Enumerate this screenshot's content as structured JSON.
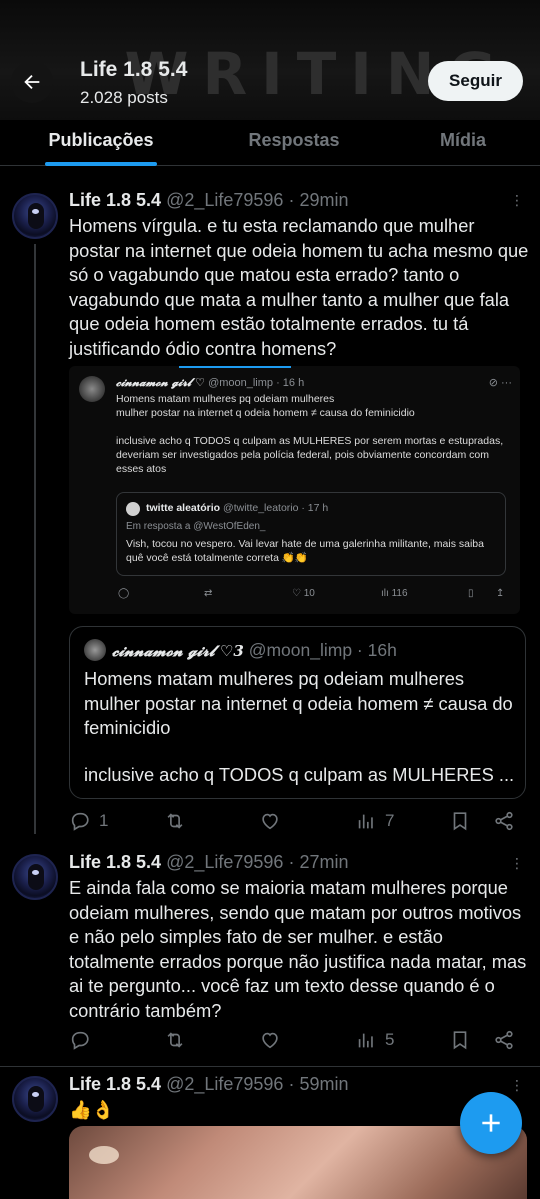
{
  "header": {
    "banner_text": "WRITING",
    "profile_name": "Life 1.8 5.4",
    "post_count": "2.028 posts",
    "follow_label": "Seguir"
  },
  "tabs": [
    {
      "label": "Publicações",
      "active": true
    },
    {
      "label": "Respostas",
      "active": false
    },
    {
      "label": "Mídia",
      "active": false
    }
  ],
  "posts": [
    {
      "name": "Life 1.8 5.4",
      "handle_time": "@2_Life79596 · 29min",
      "text": "Homens vírgula. e tu esta reclamando que mulher postar na internet que odeia homem tu acha mesmo que só o vagabundo que matou esta errado? tanto o vagabundo que mata a mulher tanto a mulher que fala que odeia homem estão totalmente errados. tu tá justificando ódio contra homens?",
      "replies": "1",
      "views": "7"
    },
    {
      "name": "Life 1.8 5.4",
      "handle_time": "@2_Life79596 · 27min",
      "text": "E ainda fala como se maioria matam mulheres porque odeiam mulheres, sendo que matam por outros motivos e não pelo simples fato de ser mulher. e estão totalmente errados porque não justifica nada matar, mas ai te pergunto... você faz um texto desse quando é o contrário também?",
      "views": "5"
    },
    {
      "name": "Life 1.8 5.4",
      "handle_time": "@2_Life79596 · 59min",
      "text": "👍👌"
    }
  ],
  "screenshot": {
    "author": "𝓬𝓲𝓷𝓷𝓪𝓶𝓸𝓷 𝓰𝓲𝓻𝓵 ♡",
    "handle_time": "@moon_limp · 16 h",
    "text": "Homens matam mulheres pq odeiam mulheres\nmulher postar na internet q odeia homem ≠ causa do feminicidio\n\ninclusive acho q TODOS q culpam as MULHERES por serem mortas e estupradas, deveriam ser investigados pela polícia federal, pois obviamente concordam com esses atos",
    "inner_author": "twitte aleatório",
    "inner_handle_time": "@twitte_leatorio · 17 h",
    "inner_reply_to": "Em resposta a @WestOfEden_",
    "inner_text": "Vish, tocou no vespero. Vai levar hate de uma galerinha militante, mais saiba quê você está totalmente correta 👏👏",
    "likes": "10",
    "views": "116"
  },
  "quote": {
    "author": "𝓬𝓲𝓷𝓷𝓪𝓶𝓸𝓷 𝓰𝓲𝓻𝓵 ♡3",
    "handle_time": "@moon_limp · 16h",
    "text": "Homens matam mulheres pq odeiam mulheres mulher postar na internet q odeia homem ≠ causa do feminicidio",
    "text_more": "inclusive acho q TODOS q culpam as MULHERES ..."
  },
  "fab_label": "+"
}
